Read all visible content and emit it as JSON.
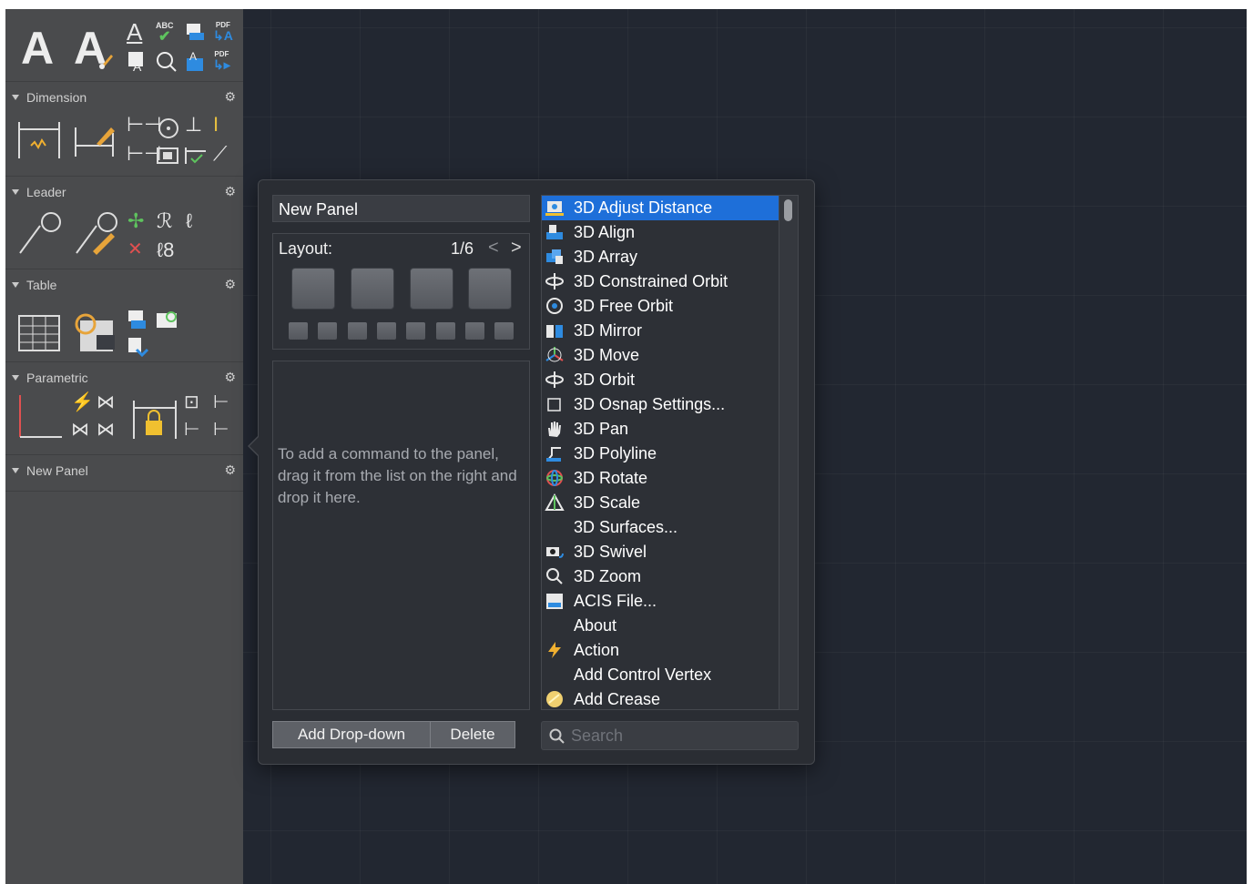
{
  "palette": {
    "sections": [
      {
        "label": "Dimension"
      },
      {
        "label": "Leader"
      },
      {
        "label": "Table"
      },
      {
        "label": "Parametric"
      },
      {
        "label": "New Panel"
      }
    ],
    "text_tool_glyphs": [
      "A",
      "A"
    ],
    "text_mini_labels": [
      "ABC",
      "PDF",
      "PDF"
    ]
  },
  "popover": {
    "panel_name": "New Panel",
    "layout_label": "Layout:",
    "layout_page": "1/6",
    "layout_prev": "<",
    "layout_next": ">",
    "drop_hint": "To add a command to the panel, drag it from the list on the right and drop it here.",
    "add_dropdown_label": "Add Drop-down",
    "delete_label": "Delete",
    "search_placeholder": "Search"
  },
  "commands": [
    {
      "label": "3D Adjust Distance",
      "icon": "camera-distance-icon",
      "selected": true
    },
    {
      "label": "3D Align",
      "icon": "align-icon"
    },
    {
      "label": "3D Array",
      "icon": "array-icon"
    },
    {
      "label": "3D Constrained Orbit",
      "icon": "constrained-orbit-icon"
    },
    {
      "label": "3D Free Orbit",
      "icon": "free-orbit-icon"
    },
    {
      "label": "3D Mirror",
      "icon": "mirror-icon"
    },
    {
      "label": "3D Move",
      "icon": "move-gizmo-icon"
    },
    {
      "label": "3D Orbit",
      "icon": "orbit-icon"
    },
    {
      "label": "3D Osnap Settings...",
      "icon": "osnap-icon"
    },
    {
      "label": "3D Pan",
      "icon": "hand-icon"
    },
    {
      "label": "3D Polyline",
      "icon": "polyline-icon"
    },
    {
      "label": "3D Rotate",
      "icon": "rotate-gizmo-icon"
    },
    {
      "label": "3D Scale",
      "icon": "scale-gizmo-icon"
    },
    {
      "label": "3D Surfaces...",
      "icon": ""
    },
    {
      "label": "3D Swivel",
      "icon": "swivel-camera-icon"
    },
    {
      "label": "3D Zoom",
      "icon": "zoom-icon"
    },
    {
      "label": "ACIS File...",
      "icon": "acis-file-icon"
    },
    {
      "label": "About",
      "icon": ""
    },
    {
      "label": "Action",
      "icon": "lightning-icon"
    },
    {
      "label": "Add Control Vertex",
      "icon": ""
    },
    {
      "label": "Add Crease",
      "icon": "crease-icon"
    }
  ],
  "colors": {
    "selection": "#1e6fd9",
    "palette_bg": "#4a4b4d",
    "canvas_bg": "#222731",
    "popover_bg": "#2a2d33"
  }
}
